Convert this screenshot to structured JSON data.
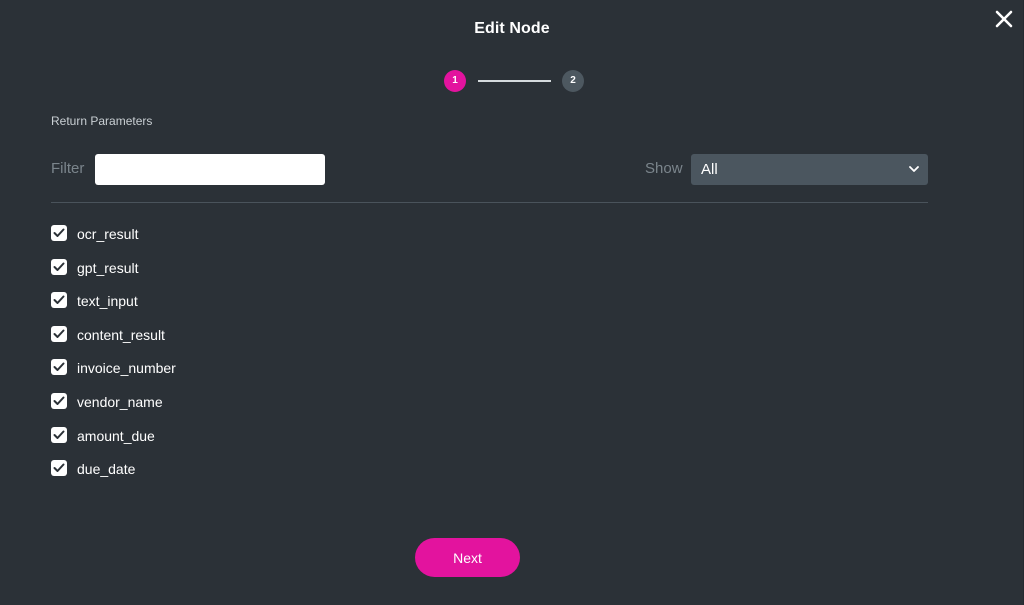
{
  "modal": {
    "title": "Edit Node"
  },
  "stepper": {
    "steps": [
      {
        "label": "1",
        "active": true
      },
      {
        "label": "2",
        "active": false
      }
    ]
  },
  "section": {
    "label": "Return Parameters"
  },
  "filter": {
    "label": "Filter",
    "value": "",
    "placeholder": ""
  },
  "show": {
    "label": "Show",
    "selected": "All"
  },
  "parameters": [
    {
      "name": "ocr_result",
      "checked": true
    },
    {
      "name": "gpt_result",
      "checked": true
    },
    {
      "name": "text_input",
      "checked": true
    },
    {
      "name": "content_result",
      "checked": true
    },
    {
      "name": "invoice_number",
      "checked": true
    },
    {
      "name": "vendor_name",
      "checked": true
    },
    {
      "name": "amount_due",
      "checked": true
    },
    {
      "name": "due_date",
      "checked": true
    }
  ],
  "footer": {
    "next_label": "Next"
  },
  "colors": {
    "background": "#2b3137",
    "accent": "#e3139e",
    "select_bg": "#4b565f",
    "inactive_step": "#4d5860"
  },
  "icons": {
    "close": "close-icon",
    "dropdown": "chevron-down-icon",
    "check": "checkmark-icon"
  }
}
